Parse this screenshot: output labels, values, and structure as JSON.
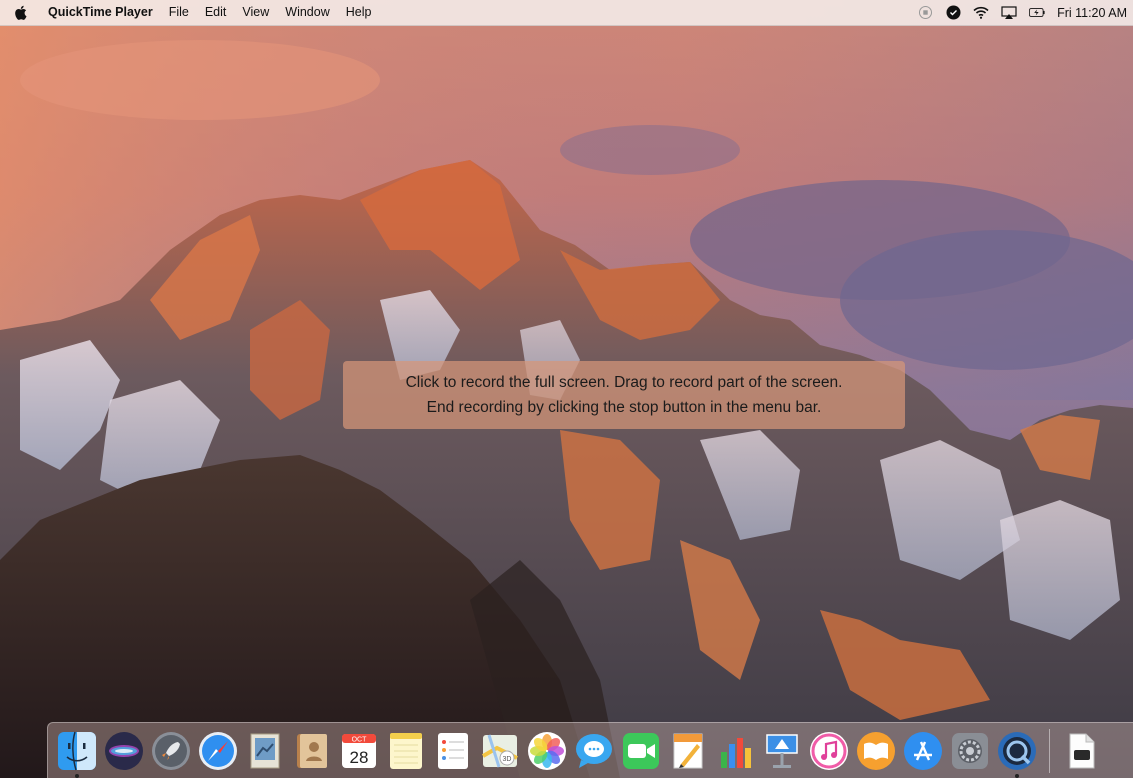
{
  "menubar": {
    "app_name": "QuickTime Player",
    "menus": [
      "File",
      "Edit",
      "View",
      "Window",
      "Help"
    ],
    "clock": "Fri 11:20 AM"
  },
  "hint": {
    "line1": "Click to record the full screen. Drag to record part of the screen.",
    "line2": "End recording by clicking the stop button in the menu bar."
  },
  "dock": {
    "calendar_month": "OCT",
    "calendar_day": "28",
    "items": [
      "finder-icon",
      "siri-icon",
      "launchpad-icon",
      "safari-icon",
      "mail-icon",
      "contacts-icon",
      "calendar-icon",
      "notes-icon",
      "reminders-icon",
      "maps-icon",
      "photos-icon",
      "messages-icon",
      "facetime-icon",
      "pages-icon",
      "numbers-icon",
      "keynote-icon",
      "itunes-icon",
      "ibooks-icon",
      "app-store-icon",
      "system-preferences-icon",
      "quicktime-icon",
      "document-icon"
    ]
  }
}
